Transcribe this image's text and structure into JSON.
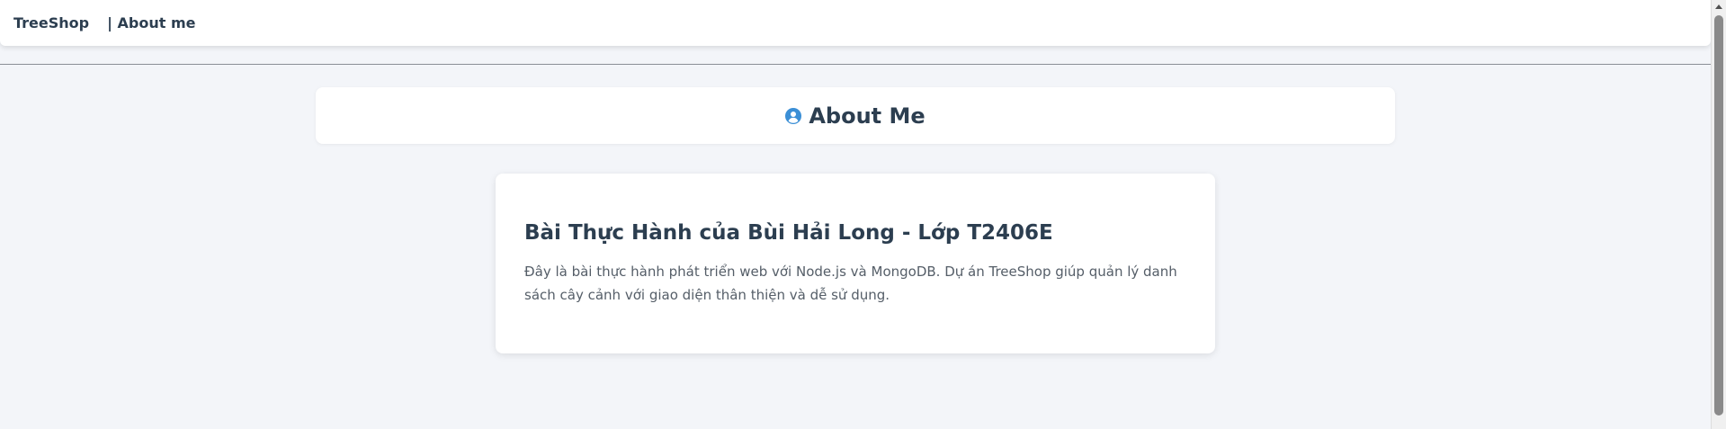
{
  "navbar": {
    "brand": "TreeShop",
    "links": [
      {
        "label": "| About me"
      }
    ]
  },
  "header": {
    "icon": "user-circle-icon",
    "title": "About Me",
    "icon_color": "#3b8fd6"
  },
  "content": {
    "heading": "Bài Thực Hành của Bùi Hải Long - Lớp T2406E",
    "paragraph": "Đây là bài thực hành phát triển web với Node.js và MongoDB. Dự án TreeShop giúp quản lý danh sách cây cảnh với giao diện thân thiện và dễ sử dụng."
  },
  "colors": {
    "background": "#f3f5f9",
    "card": "#ffffff",
    "text_primary": "#2c3e50",
    "text_secondary": "#555e68",
    "accent": "#3b8fd6"
  }
}
